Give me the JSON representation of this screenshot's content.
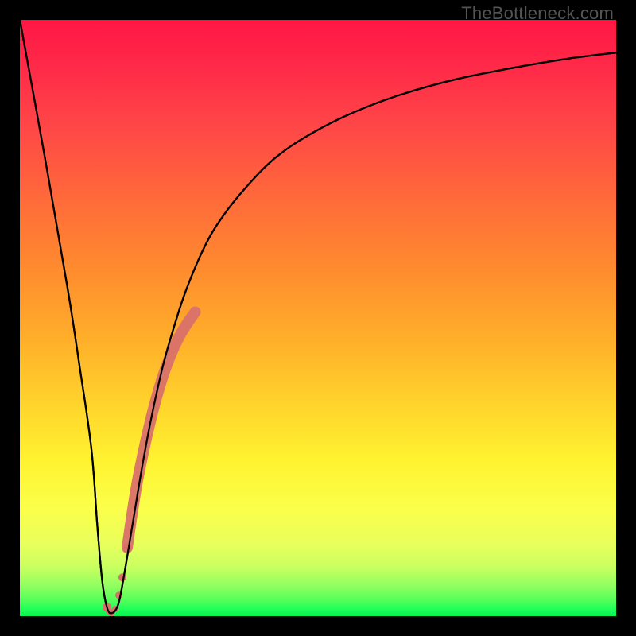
{
  "watermark": "TheBottleneck.com",
  "chart_data": {
    "type": "line",
    "title": "",
    "xlabel": "",
    "ylabel": "",
    "xlim": [
      0,
      100
    ],
    "ylim": [
      0,
      100
    ],
    "series": [
      {
        "name": "bottleneck-curve",
        "x": [
          0,
          4,
          8,
          10,
          12,
          13,
          13.8,
          14.6,
          15.4,
          16.5,
          17.5,
          19,
          20.5,
          22,
          24,
          26,
          28,
          31,
          34,
          38,
          43,
          49,
          56,
          64,
          73,
          83,
          92,
          100
        ],
        "values": [
          100,
          78,
          55,
          42,
          28,
          15,
          6,
          1.5,
          0.5,
          2,
          7,
          16,
          25,
          33,
          42,
          49,
          55,
          62,
          67,
          72,
          77,
          81,
          84.5,
          87.5,
          90,
          92,
          93.5,
          94.5
        ]
      }
    ],
    "highlight_segment": {
      "name": "hotspot-overlay",
      "color": "#d9716a",
      "x": [
        14.6,
        15.0,
        15.4,
        16.0,
        16.6,
        17.2,
        18.0,
        18.8,
        19.6,
        20.6,
        21.6,
        22.6,
        23.6,
        24.6,
        25.6,
        26.8,
        28.0,
        29.4
      ],
      "values": [
        1.5,
        0.8,
        0.5,
        1.2,
        3.5,
        6.5,
        11.5,
        17.0,
        22.0,
        27.0,
        31.5,
        35.5,
        39.0,
        42.0,
        44.5,
        47.0,
        49.0,
        51.0
      ]
    }
  }
}
